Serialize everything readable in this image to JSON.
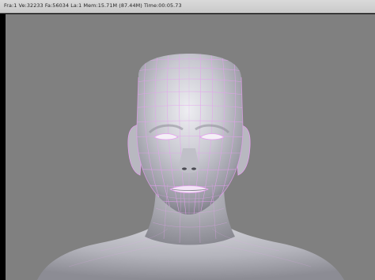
{
  "app": {
    "status_info": "Fra:1  Ve:32233 Fa:56034  La:1  Mem:15.71M (87.44M) Time:00:05.73"
  },
  "viewport": {
    "subject": "sculpted head mesh with wireframe overlay",
    "background_color": "#808080",
    "mesh_color": "#cfcfd6",
    "wire_color": "#e6a0f0"
  }
}
